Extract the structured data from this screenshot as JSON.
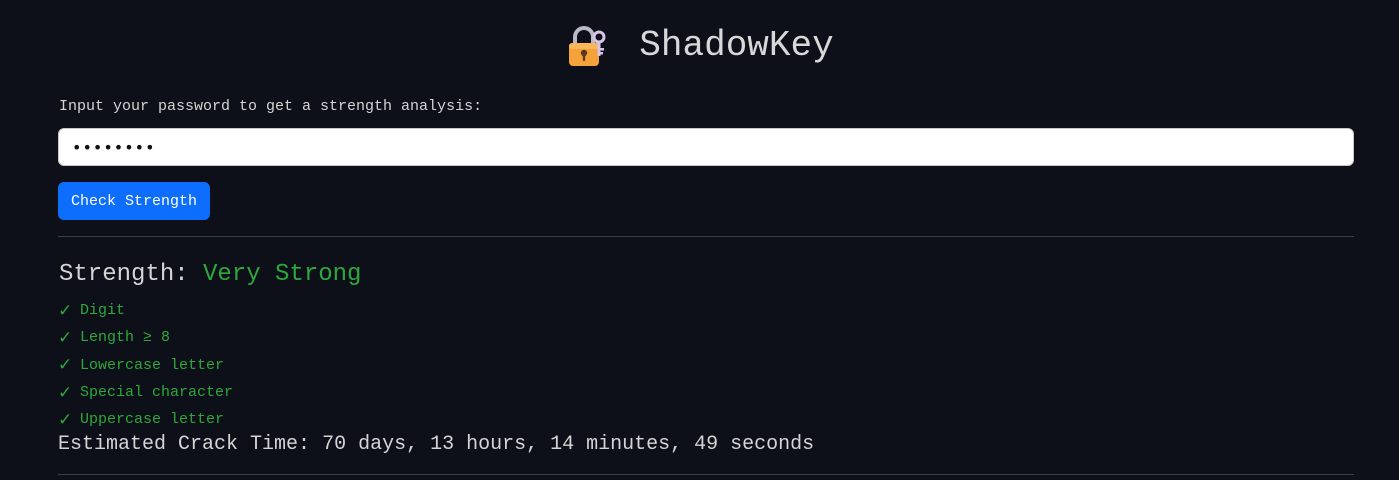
{
  "header": {
    "title": "ShadowKey",
    "icon": "lock-with-key-icon"
  },
  "form": {
    "prompt": "Input your password to get a strength analysis:",
    "password_value": "PassW0rd",
    "check_button_label": "Check Strength"
  },
  "result": {
    "strength_label": "Strength:",
    "strength_value": "Very Strong",
    "strength_color": "#2ea83a",
    "criteria": [
      {
        "label": "Digit",
        "met": true
      },
      {
        "label": "Length ≥ 8",
        "met": true
      },
      {
        "label": "Lowercase letter",
        "met": true
      },
      {
        "label": "Special character",
        "met": true
      },
      {
        "label": "Uppercase letter",
        "met": true
      }
    ],
    "crack_time_label": "Estimated Crack Time:",
    "crack_time_value": "70 days, 13 hours, 14 minutes, 49 seconds"
  },
  "colors": {
    "background": "#0d1019",
    "button": "#0d6efd",
    "success": "#2ea83a"
  }
}
